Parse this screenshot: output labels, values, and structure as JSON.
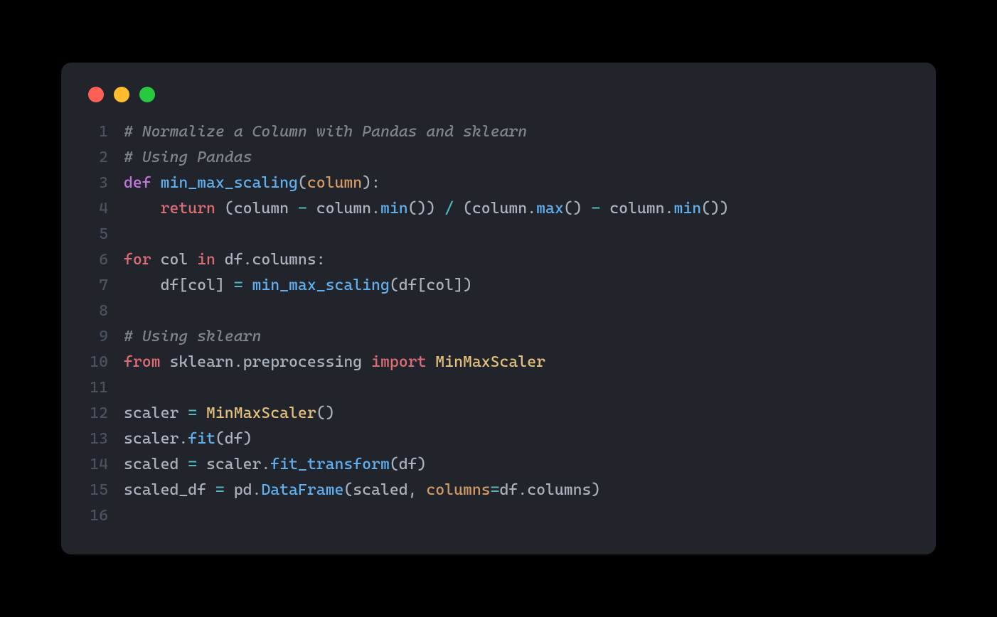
{
  "colors": {
    "bg": "#000000",
    "window_bg": "#21252b",
    "gutter": "#4b5363",
    "text": "#abb2bf",
    "comment": "#7f848e",
    "keyword_purple": "#c678dd",
    "keyword_red": "#e06c75",
    "func_blue": "#61afef",
    "param_orange": "#d19a66",
    "ident_yellow": "#e5c07b",
    "op_cyan": "#56b6c2",
    "dot_red": "#ff5f56",
    "dot_yellow": "#ffbd2e",
    "dot_green": "#27c93f"
  },
  "lines": [
    {
      "n": "1",
      "tokens": [
        {
          "t": "# Normalize a Column with Pandas and sklearn",
          "c": "c-comment"
        }
      ]
    },
    {
      "n": "2",
      "tokens": [
        {
          "t": "# Using Pandas",
          "c": "c-comment"
        }
      ]
    },
    {
      "n": "3",
      "tokens": [
        {
          "t": "def ",
          "c": "c-keyword"
        },
        {
          "t": "min_max_scaling",
          "c": "c-func"
        },
        {
          "t": "(",
          "c": "c-punct"
        },
        {
          "t": "column",
          "c": "c-param"
        },
        {
          "t": "):",
          "c": "c-punct"
        }
      ]
    },
    {
      "n": "4",
      "tokens": [
        {
          "t": "    ",
          "c": "c-plain"
        },
        {
          "t": "return",
          "c": "c-keyword2"
        },
        {
          "t": " (column ",
          "c": "c-plain"
        },
        {
          "t": "-",
          "c": "c-op"
        },
        {
          "t": " column.",
          "c": "c-plain"
        },
        {
          "t": "min",
          "c": "c-call"
        },
        {
          "t": "()) ",
          "c": "c-plain"
        },
        {
          "t": "/",
          "c": "c-op"
        },
        {
          "t": " (column.",
          "c": "c-plain"
        },
        {
          "t": "max",
          "c": "c-call"
        },
        {
          "t": "() ",
          "c": "c-plain"
        },
        {
          "t": "-",
          "c": "c-op"
        },
        {
          "t": " column.",
          "c": "c-plain"
        },
        {
          "t": "min",
          "c": "c-call"
        },
        {
          "t": "())",
          "c": "c-plain"
        }
      ]
    },
    {
      "n": "5",
      "tokens": [
        {
          "t": "",
          "c": "c-plain"
        }
      ]
    },
    {
      "n": "6",
      "tokens": [
        {
          "t": "for",
          "c": "c-keyword2"
        },
        {
          "t": " col ",
          "c": "c-plain"
        },
        {
          "t": "in",
          "c": "c-keyword2"
        },
        {
          "t": " df.columns:",
          "c": "c-plain"
        }
      ]
    },
    {
      "n": "7",
      "tokens": [
        {
          "t": "    df[col] ",
          "c": "c-plain"
        },
        {
          "t": "=",
          "c": "c-op"
        },
        {
          "t": " ",
          "c": "c-plain"
        },
        {
          "t": "min_max_scaling",
          "c": "c-call"
        },
        {
          "t": "(df[col])",
          "c": "c-plain"
        }
      ]
    },
    {
      "n": "8",
      "tokens": [
        {
          "t": "",
          "c": "c-plain"
        }
      ]
    },
    {
      "n": "9",
      "tokens": [
        {
          "t": "# Using sklearn",
          "c": "c-comment"
        }
      ]
    },
    {
      "n": "10",
      "tokens": [
        {
          "t": "from",
          "c": "c-keyword2"
        },
        {
          "t": " sklearn.preprocessing ",
          "c": "c-plain"
        },
        {
          "t": "import",
          "c": "c-keyword2"
        },
        {
          "t": " MinMaxScaler",
          "c": "c-ident"
        }
      ]
    },
    {
      "n": "11",
      "tokens": [
        {
          "t": "",
          "c": "c-plain"
        }
      ]
    },
    {
      "n": "12",
      "tokens": [
        {
          "t": "scaler ",
          "c": "c-plain"
        },
        {
          "t": "=",
          "c": "c-op"
        },
        {
          "t": " ",
          "c": "c-plain"
        },
        {
          "t": "MinMaxScaler",
          "c": "c-ident"
        },
        {
          "t": "()",
          "c": "c-plain"
        }
      ]
    },
    {
      "n": "13",
      "tokens": [
        {
          "t": "scaler.",
          "c": "c-plain"
        },
        {
          "t": "fit",
          "c": "c-call"
        },
        {
          "t": "(df)",
          "c": "c-plain"
        }
      ]
    },
    {
      "n": "14",
      "tokens": [
        {
          "t": "scaled ",
          "c": "c-plain"
        },
        {
          "t": "=",
          "c": "c-op"
        },
        {
          "t": " scaler.",
          "c": "c-plain"
        },
        {
          "t": "fit_transform",
          "c": "c-call"
        },
        {
          "t": "(df)",
          "c": "c-plain"
        }
      ]
    },
    {
      "n": "15",
      "tokens": [
        {
          "t": "scaled_df ",
          "c": "c-plain"
        },
        {
          "t": "=",
          "c": "c-op"
        },
        {
          "t": " pd.",
          "c": "c-plain"
        },
        {
          "t": "DataFrame",
          "c": "c-call"
        },
        {
          "t": "(scaled, ",
          "c": "c-plain"
        },
        {
          "t": "columns",
          "c": "c-param"
        },
        {
          "t": "=",
          "c": "c-op"
        },
        {
          "t": "df.columns)",
          "c": "c-plain"
        }
      ]
    },
    {
      "n": "16",
      "tokens": [
        {
          "t": "",
          "c": "c-plain"
        }
      ]
    }
  ]
}
